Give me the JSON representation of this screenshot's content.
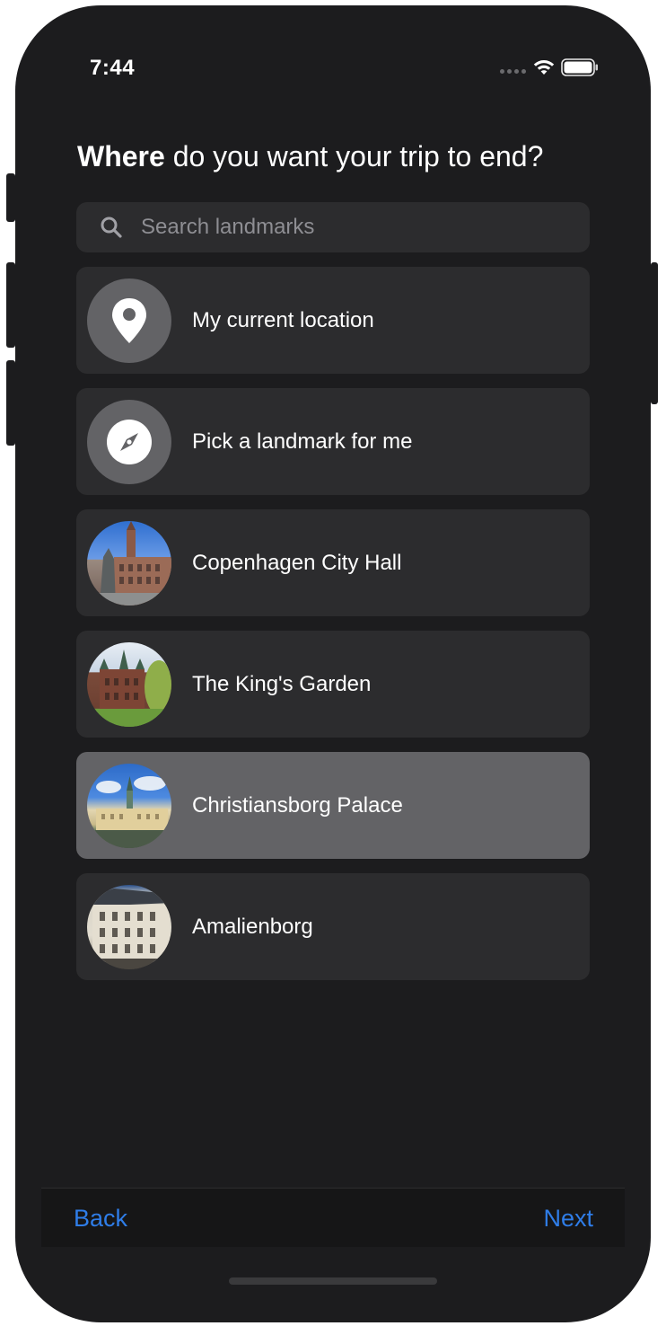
{
  "status_bar": {
    "time": "7:44"
  },
  "prompt": {
    "bold": "Where",
    "rest": " do you want your trip to end?"
  },
  "search": {
    "placeholder": "Search landmarks",
    "value": ""
  },
  "options": [
    {
      "label": "My current location",
      "icon": "location-pin-icon",
      "selected": false
    },
    {
      "label": "Pick a landmark for me",
      "icon": "compass-icon",
      "selected": false
    },
    {
      "label": "Copenhagen City Hall",
      "icon": "landmark-photo",
      "selected": false
    },
    {
      "label": "The King's Garden",
      "icon": "landmark-photo",
      "selected": false
    },
    {
      "label": "Christiansborg Palace",
      "icon": "landmark-photo",
      "selected": true
    },
    {
      "label": "Amalienborg",
      "icon": "landmark-photo",
      "selected": false
    }
  ],
  "footer": {
    "back_label": "Back",
    "next_label": "Next"
  },
  "colors": {
    "background": "#1c1c1e",
    "row": "#2c2c2e",
    "selected_row": "#636366",
    "accent": "#2f7de8"
  }
}
